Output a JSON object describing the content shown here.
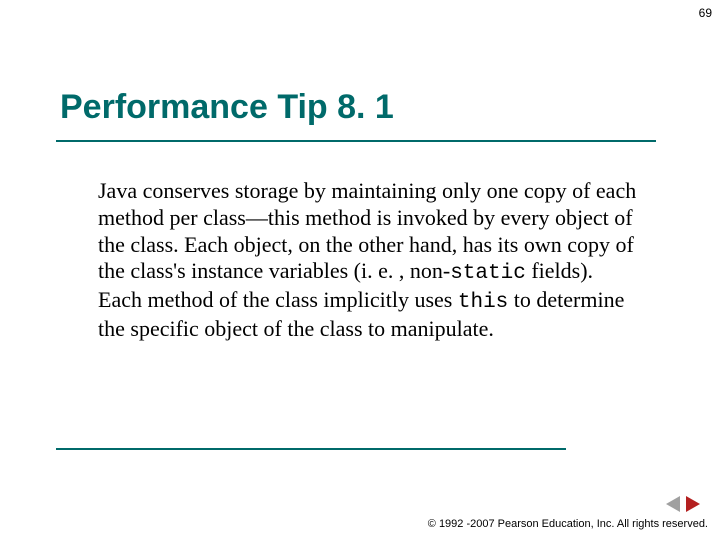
{
  "page_number": "69",
  "heading": "Performance Tip 8. 1",
  "body": {
    "p1": "Java conserves storage by maintaining only one copy of each method per class—this method is invoked by every object of the class. Each object, on the other hand, has its own copy of the class's instance variables (i. e. , non-",
    "mono1": "static",
    "p2": " fields). Each method of the class implicitly uses ",
    "mono2": "this",
    "p3": " to determine the specific object of the class to manipulate."
  },
  "copyright": "© 1992 -2007 Pearson Education, Inc.  All rights reserved.",
  "colors": {
    "accent": "#006a6a",
    "nav_prev": "#a0a0a0",
    "nav_next": "#b42020"
  }
}
